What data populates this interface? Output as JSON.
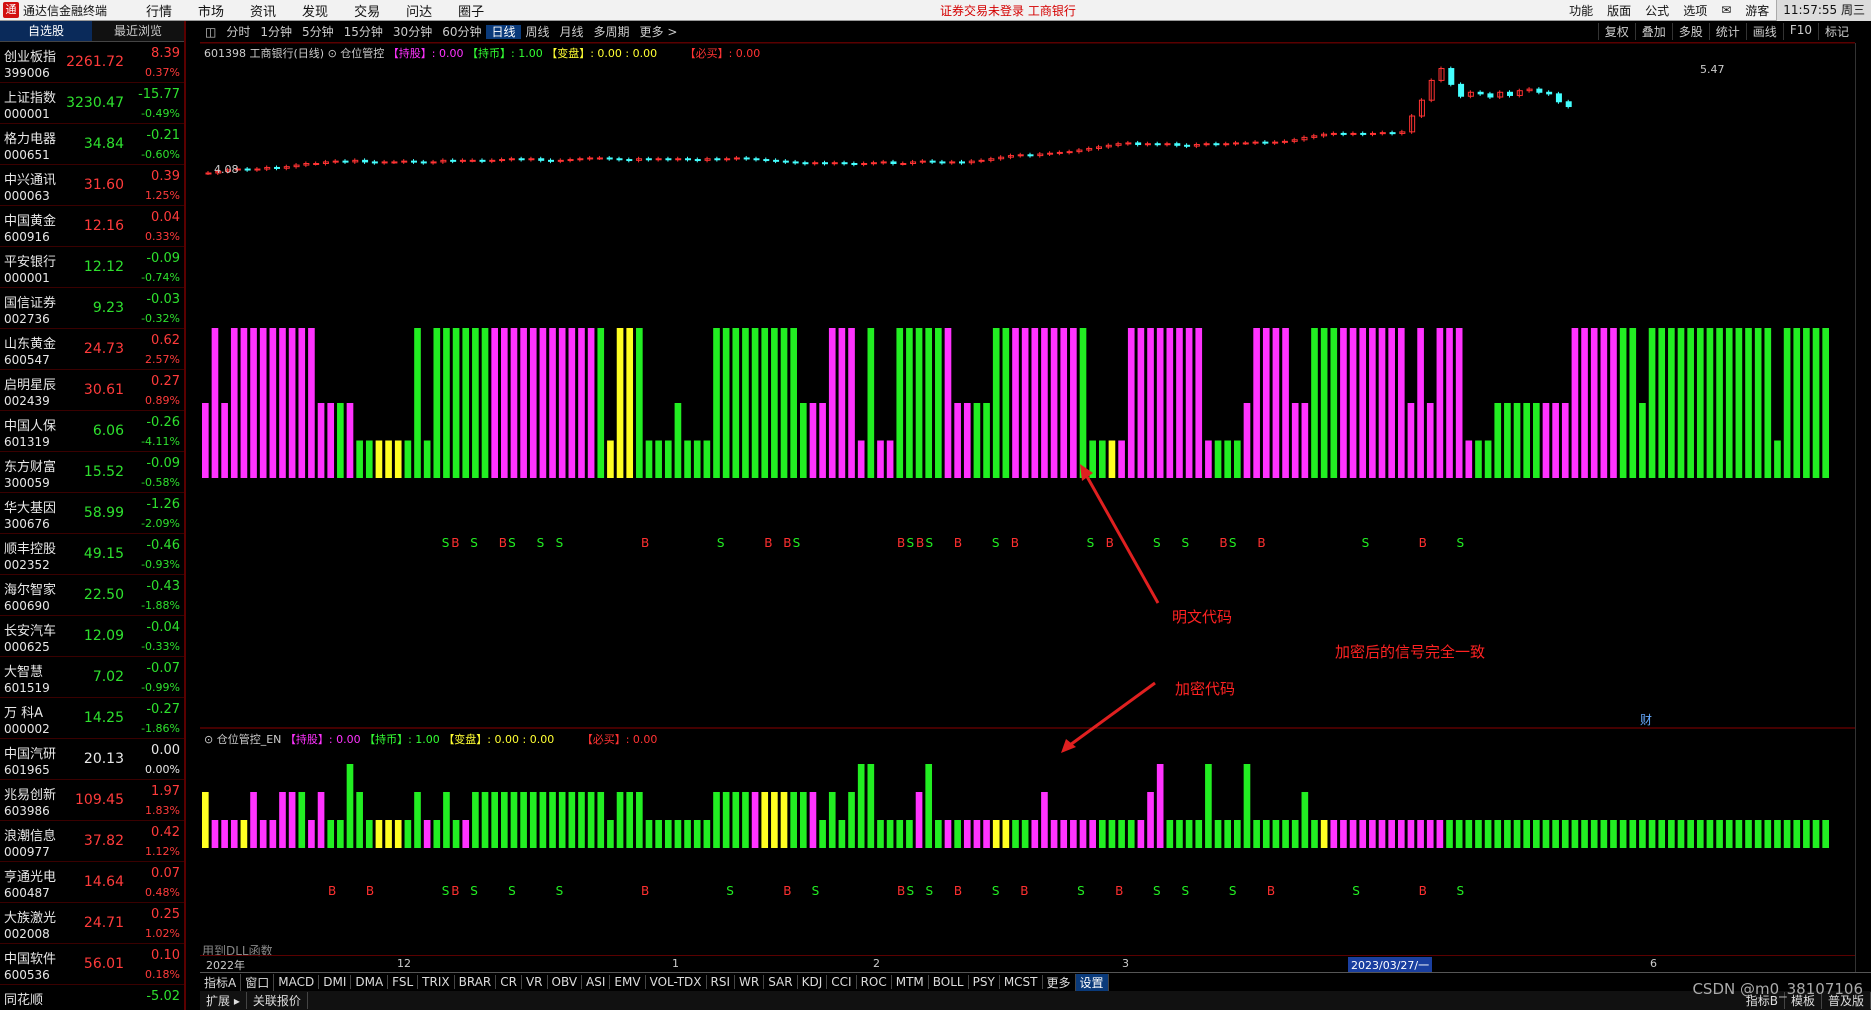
{
  "app": {
    "logo_glyph": "通",
    "title": "通达信金融终端",
    "menu": [
      "行情",
      "市场",
      "资讯",
      "发现",
      "交易",
      "问达",
      "圈子"
    ],
    "notice": "证券交易未登录   工商银行",
    "right_menu": [
      "功能",
      "版面",
      "公式",
      "选项",
      "✉",
      "游客"
    ],
    "time": "11:57:55 周三"
  },
  "watchlist": {
    "tabs": [
      "自选股",
      "最近浏览"
    ],
    "items": [
      {
        "name": "创业板指",
        "code": "399006",
        "price": "2261.72",
        "change": "8.39",
        "pct": "0.37%",
        "dir": "up"
      },
      {
        "name": "上证指数",
        "code": "000001",
        "price": "3230.47",
        "change": "-15.77",
        "pct": "-0.49%",
        "dir": "dn"
      },
      {
        "name": "格力电器",
        "code": "000651",
        "price": "34.84",
        "change": "-0.21",
        "pct": "-0.60%",
        "dir": "dn"
      },
      {
        "name": "中兴通讯",
        "code": "000063",
        "price": "31.60",
        "change": "0.39",
        "pct": "1.25%",
        "dir": "up"
      },
      {
        "name": "中国黄金",
        "code": "600916",
        "price": "12.16",
        "change": "0.04",
        "pct": "0.33%",
        "dir": "up"
      },
      {
        "name": "平安银行",
        "code": "000001",
        "price": "12.12",
        "change": "-0.09",
        "pct": "-0.74%",
        "dir": "dn"
      },
      {
        "name": "国信证券",
        "code": "002736",
        "price": "9.23",
        "change": "-0.03",
        "pct": "-0.32%",
        "dir": "dn"
      },
      {
        "name": "山东黄金",
        "code": "600547",
        "price": "24.73",
        "change": "0.62",
        "pct": "2.57%",
        "dir": "up"
      },
      {
        "name": "启明星辰",
        "code": "002439",
        "price": "30.61",
        "change": "0.27",
        "pct": "0.89%",
        "dir": "up"
      },
      {
        "name": "中国人保",
        "code": "601319",
        "price": "6.06",
        "change": "-0.26",
        "pct": "-4.11%",
        "dir": "dn"
      },
      {
        "name": "东方财富",
        "code": "300059",
        "price": "15.52",
        "change": "-0.09",
        "pct": "-0.58%",
        "dir": "dn"
      },
      {
        "name": "华大基因",
        "code": "300676",
        "price": "58.99",
        "change": "-1.26",
        "pct": "-2.09%",
        "dir": "dn"
      },
      {
        "name": "顺丰控股",
        "code": "002352",
        "price": "49.15",
        "change": "-0.46",
        "pct": "-0.93%",
        "dir": "dn"
      },
      {
        "name": "海尔智家",
        "code": "600690",
        "price": "22.50",
        "change": "-0.43",
        "pct": "-1.88%",
        "dir": "dn"
      },
      {
        "name": "长安汽车",
        "code": "000625",
        "price": "12.09",
        "change": "-0.04",
        "pct": "-0.33%",
        "dir": "dn"
      },
      {
        "name": "大智慧",
        "code": "601519",
        "price": "7.02",
        "change": "-0.07",
        "pct": "-0.99%",
        "dir": "dn"
      },
      {
        "name": "万 科A",
        "code": "000002",
        "price": "14.25",
        "change": "-0.27",
        "pct": "-1.86%",
        "dir": "dn"
      },
      {
        "name": "中国汽研",
        "code": "601965",
        "price": "20.13",
        "change": "0.00",
        "pct": "0.00%",
        "dir": "flat"
      },
      {
        "name": "兆易创新",
        "code": "603986",
        "price": "109.45",
        "change": "1.97",
        "pct": "1.83%",
        "dir": "up"
      },
      {
        "name": "浪潮信息",
        "code": "000977",
        "price": "37.82",
        "change": "0.42",
        "pct": "1.12%",
        "dir": "up"
      },
      {
        "name": "亨通光电",
        "code": "600487",
        "price": "14.64",
        "change": "0.07",
        "pct": "0.48%",
        "dir": "up"
      },
      {
        "name": "大族激光",
        "code": "002008",
        "price": "24.71",
        "change": "0.25",
        "pct": "1.02%",
        "dir": "up"
      },
      {
        "name": "中国软件",
        "code": "600536",
        "price": "56.01",
        "change": "0.10",
        "pct": "0.18%",
        "dir": "up"
      },
      {
        "name": "同花顺",
        "code": "",
        "price": "",
        "change": "-5.02",
        "pct": "",
        "dir": "dn"
      }
    ]
  },
  "toolbar": {
    "periods": [
      "分时",
      "1分钟",
      "5分钟",
      "15分钟",
      "30分钟",
      "60分钟",
      "日线",
      "周线",
      "月线",
      "多周期",
      "更多 >"
    ],
    "active_period": "日线",
    "tools": [
      "复权",
      "叠加",
      "多股",
      "统计",
      "画线",
      "F10",
      "标记"
    ]
  },
  "main_chart": {
    "stock_title": "601398 工商银行(日线)",
    "indicator": "仓位管控",
    "legend": {
      "hold": "【持股】: 0.00",
      "coin": "【持币】: 1.00",
      "change": "【变盘】: 0.00 : 0.00",
      "buy": "【必买】: 0.00"
    },
    "high_label": "5.47",
    "low_label": "4.08"
  },
  "lower_panel": {
    "indicator": "仓位管控_EN",
    "legend": {
      "hold": "【持股】: 0.00",
      "coin": "【持币】: 1.00",
      "change": "【变盘】: 0.00 : 0.00",
      "buy": "【必买】: 0.00"
    },
    "fin_mark": "财",
    "hint": "用到DLL函数"
  },
  "annotations": {
    "plain_code": "明文代码",
    "same_signal": "加密后的信号完全一致",
    "encrypted_code": "加密代码"
  },
  "date_axis": {
    "labels": [
      "2022年",
      "12",
      "1",
      "2",
      "3",
      "6"
    ],
    "cursor_date": "2023/03/27/一"
  },
  "indicator_tabs": [
    "指标A",
    "窗口",
    "MACD",
    "DMI",
    "DMA",
    "FSL",
    "TRIX",
    "BRAR",
    "CR",
    "VR",
    "OBV",
    "ASI",
    "EMV",
    "VOL-TDX",
    "RSI",
    "WR",
    "SAR",
    "KDJ",
    "CCI",
    "ROC",
    "MTM",
    "BOLL",
    "PSY",
    "MCST",
    "更多",
    "设置"
  ],
  "active_indicator_tab": "设置",
  "status_bar": [
    "扩展 ▸",
    "关联报价"
  ],
  "right_tabs": [
    "指标B",
    "模板",
    "普及版"
  ],
  "watermark": "CSDN @m0_38107106",
  "chart_data": [
    {
      "type": "bar",
      "name": "仓位管控",
      "colors": {
        "hold": "#ff33ff",
        "coin": "#22ee22",
        "change": "#ffff22"
      },
      "levels": [
        2,
        4,
        2,
        4,
        4,
        4,
        4,
        4,
        4,
        4,
        4,
        4,
        2,
        2,
        2,
        2,
        1,
        1,
        1,
        1,
        1,
        1,
        4,
        1,
        4,
        4,
        4,
        4,
        4,
        4,
        4,
        4,
        4,
        4,
        4,
        4,
        4,
        4,
        4,
        4,
        4,
        4,
        1,
        4,
        4,
        4,
        1,
        1,
        1,
        2,
        1,
        1,
        1,
        4,
        4,
        4,
        4,
        4,
        4,
        4,
        4,
        4,
        2,
        2,
        2,
        4,
        4,
        4,
        1,
        4,
        1,
        1,
        4,
        4,
        4,
        4,
        4,
        4,
        2,
        2,
        2,
        2,
        4,
        4,
        4,
        4,
        4,
        4,
        4,
        4,
        4,
        4,
        1,
        1,
        1,
        1,
        4,
        4,
        4,
        4,
        4,
        4,
        4,
        4,
        1,
        1,
        1,
        1,
        2,
        4,
        4,
        4,
        4,
        2,
        2,
        4,
        4,
        4,
        4,
        4,
        4,
        4,
        4,
        4,
        4,
        2,
        4,
        2,
        4,
        4,
        4,
        1,
        1,
        1,
        2,
        2,
        2,
        2,
        2,
        2,
        2,
        2,
        4,
        4,
        4,
        4,
        4,
        4,
        4,
        2,
        4,
        4,
        4,
        4,
        4,
        4,
        4,
        4,
        4,
        4,
        4,
        4,
        4,
        1,
        4,
        4,
        4,
        4,
        4
      ],
      "kinds": [
        "h",
        "h",
        "h",
        "h",
        "h",
        "h",
        "h",
        "h",
        "h",
        "h",
        "h",
        "h",
        "h",
        "h",
        "c",
        "h",
        "g",
        "c",
        "y",
        "y",
        "y",
        "c",
        "c",
        "g",
        "c",
        "c",
        "c",
        "c",
        "c",
        "c",
        "h",
        "h",
        "h",
        "h",
        "h",
        "h",
        "h",
        "h",
        "h",
        "h",
        "h",
        "c",
        "y",
        "y",
        "y",
        "c",
        "c",
        "c",
        "c",
        "c",
        "c",
        "c",
        "c",
        "c",
        "c",
        "c",
        "c",
        "c",
        "c",
        "c",
        "c",
        "c",
        "c",
        "h",
        "h",
        "h",
        "h",
        "h",
        "h",
        "c",
        "h",
        "h",
        "c",
        "c",
        "c",
        "c",
        "c",
        "h",
        "h",
        "h",
        "c",
        "c",
        "c",
        "c",
        "h",
        "h",
        "h",
        "h",
        "h",
        "h",
        "h",
        "c",
        "c",
        "c",
        "y",
        "h",
        "h",
        "h",
        "h",
        "h",
        "h",
        "h",
        "h",
        "h",
        "h",
        "c",
        "c",
        "c",
        "h",
        "h",
        "h",
        "h",
        "h",
        "h",
        "h",
        "c",
        "c",
        "c",
        "h",
        "h",
        "h",
        "h",
        "h",
        "h",
        "h",
        "h",
        "h",
        "h",
        "h",
        "h",
        "h",
        "h",
        "c",
        "c",
        "c",
        "c",
        "c",
        "c",
        "c",
        "h",
        "h",
        "h",
        "h",
        "h",
        "h",
        "h",
        "h",
        "c",
        "c",
        "c",
        "c",
        "c",
        "c",
        "c",
        "c",
        "c",
        "c",
        "c",
        "c",
        "c",
        "c",
        "c",
        "c",
        "c",
        "c",
        "c",
        "c",
        "c"
      ],
      "signals": [
        {
          "i": 12,
          "t": "S"
        },
        {
          "i": 13,
          "t": "B"
        },
        {
          "i": 15,
          "t": "S"
        },
        {
          "i": 18,
          "t": "B"
        },
        {
          "i": 19,
          "t": "S"
        },
        {
          "i": 22,
          "t": "S"
        },
        {
          "i": 24,
          "t": "S"
        },
        {
          "i": 33,
          "t": "B"
        },
        {
          "i": 41,
          "t": "S"
        },
        {
          "i": 46,
          "t": "B"
        },
        {
          "i": 48,
          "t": "B"
        },
        {
          "i": 49,
          "t": "S"
        },
        {
          "i": 60,
          "t": "B"
        },
        {
          "i": 61,
          "t": "S"
        },
        {
          "i": 62,
          "t": "B"
        },
        {
          "i": 63,
          "t": "S"
        },
        {
          "i": 66,
          "t": "B"
        },
        {
          "i": 70,
          "t": "S"
        },
        {
          "i": 72,
          "t": "B"
        },
        {
          "i": 80,
          "t": "S"
        },
        {
          "i": 82,
          "t": "B"
        },
        {
          "i": 87,
          "t": "S"
        },
        {
          "i": 90,
          "t": "S"
        },
        {
          "i": 94,
          "t": "B"
        },
        {
          "i": 95,
          "t": "S"
        },
        {
          "i": 98,
          "t": "B"
        },
        {
          "i": 109,
          "t": "S"
        },
        {
          "i": 115,
          "t": "B"
        },
        {
          "i": 119,
          "t": "S"
        }
      ]
    },
    {
      "type": "bar",
      "name": "仓位管控_EN",
      "levels": [
        2,
        1,
        1,
        1,
        1,
        2,
        1,
        1,
        2,
        2,
        2,
        1,
        2,
        1,
        1,
        3,
        2,
        1,
        1,
        1,
        1,
        1,
        2,
        1,
        1,
        2,
        1,
        1,
        2,
        2,
        2,
        2,
        2,
        2,
        2,
        2,
        2,
        2,
        2,
        2,
        2,
        2,
        1,
        2,
        2,
        2,
        1,
        1,
        1,
        1,
        1,
        1,
        1,
        2,
        2,
        2,
        2,
        2,
        2,
        2,
        2,
        2,
        2,
        2,
        1,
        2,
        1,
        2,
        3,
        3,
        1,
        1,
        1,
        1,
        2,
        3,
        1,
        1,
        1,
        1,
        1,
        1,
        1,
        1,
        1,
        1,
        1,
        2,
        1,
        1,
        1,
        1,
        1,
        1,
        1,
        1,
        1,
        1,
        2,
        3,
        1,
        1,
        1,
        1,
        3,
        1,
        1,
        1,
        3,
        1,
        1,
        1,
        1,
        1,
        2,
        1,
        1,
        1,
        1,
        1,
        1,
        1,
        1,
        1,
        1,
        1,
        1,
        1,
        1,
        1,
        1,
        1,
        1,
        1,
        1,
        1,
        1,
        1,
        1,
        1,
        1,
        1,
        1,
        1,
        1,
        1,
        1,
        1,
        1,
        1,
        1,
        1,
        1,
        1,
        1,
        1,
        1,
        1,
        1,
        1,
        1,
        1,
        1,
        1,
        1,
        1,
        1,
        1,
        1
      ],
      "kinds": [
        "y",
        "h",
        "h",
        "h",
        "y",
        "h",
        "h",
        "h",
        "h",
        "h",
        "g",
        "h",
        "h",
        "g",
        "g",
        "g",
        "g",
        "c",
        "y",
        "y",
        "y",
        "c",
        "c",
        "h",
        "c",
        "c",
        "c",
        "h",
        "c",
        "c",
        "c",
        "c",
        "c",
        "c",
        "c",
        "c",
        "c",
        "c",
        "c",
        "c",
        "c",
        "c",
        "c",
        "c",
        "c",
        "c",
        "c",
        "c",
        "c",
        "c",
        "c",
        "c",
        "c",
        "c",
        "c",
        "c",
        "c",
        "h",
        "y",
        "y",
        "y",
        "c",
        "c",
        "h",
        "c",
        "c",
        "c",
        "c",
        "c",
        "c",
        "c",
        "c",
        "c",
        "c",
        "h",
        "c",
        "c",
        "h",
        "c",
        "h",
        "h",
        "h",
        "y",
        "y",
        "c",
        "c",
        "h",
        "h",
        "h",
        "h",
        "h",
        "h",
        "h",
        "c",
        "c",
        "c",
        "c",
        "h",
        "h",
        "h",
        "c",
        "c",
        "c",
        "c",
        "c",
        "c",
        "c",
        "c",
        "c",
        "c",
        "c",
        "c",
        "c",
        "c",
        "c",
        "c",
        "y",
        "h",
        "h",
        "h",
        "h",
        "h",
        "h",
        "h",
        "h",
        "h",
        "h",
        "h",
        "h",
        "c",
        "c",
        "c",
        "c",
        "c",
        "c",
        "c",
        "c",
        "c",
        "c",
        "c",
        "c",
        "c",
        "c",
        "c",
        "c",
        "c",
        "c",
        "c",
        "c",
        "c",
        "c",
        "c",
        "c",
        "c",
        "c",
        "c",
        "c",
        "c",
        "c",
        "c",
        "c",
        "c",
        "c",
        "c",
        "c",
        "c",
        "c",
        "c",
        "c",
        "c",
        "c",
        "c",
        "c",
        "c"
      ],
      "signals": [
        {
          "i": 0,
          "t": "B"
        },
        {
          "i": 4,
          "t": "B"
        },
        {
          "i": 12,
          "t": "S"
        },
        {
          "i": 13,
          "t": "B"
        },
        {
          "i": 15,
          "t": "S"
        },
        {
          "i": 19,
          "t": "S"
        },
        {
          "i": 24,
          "t": "S"
        },
        {
          "i": 33,
          "t": "B"
        },
        {
          "i": 42,
          "t": "S"
        },
        {
          "i": 48,
          "t": "B"
        },
        {
          "i": 51,
          "t": "S"
        },
        {
          "i": 60,
          "t": "B"
        },
        {
          "i": 61,
          "t": "S"
        },
        {
          "i": 63,
          "t": "S"
        },
        {
          "i": 66,
          "t": "B"
        },
        {
          "i": 70,
          "t": "S"
        },
        {
          "i": 73,
          "t": "B"
        },
        {
          "i": 79,
          "t": "S"
        },
        {
          "i": 83,
          "t": "B"
        },
        {
          "i": 87,
          "t": "S"
        },
        {
          "i": 90,
          "t": "S"
        },
        {
          "i": 95,
          "t": "S"
        },
        {
          "i": 99,
          "t": "B"
        },
        {
          "i": 108,
          "t": "S"
        },
        {
          "i": 115,
          "t": "B"
        },
        {
          "i": 119,
          "t": "S"
        }
      ]
    },
    {
      "type": "candlestick",
      "name": "601398 工商银行(日线)",
      "close": [
        4.08,
        4.1,
        4.12,
        4.13,
        4.12,
        4.13,
        4.15,
        4.14,
        4.16,
        4.18,
        4.2,
        4.2,
        4.22,
        4.23,
        4.22,
        4.24,
        4.22,
        4.21,
        4.22,
        4.22,
        4.23,
        4.22,
        4.21,
        4.22,
        4.24,
        4.23,
        4.24,
        4.24,
        4.23,
        4.24,
        4.25,
        4.26,
        4.25,
        4.26,
        4.24,
        4.23,
        4.24,
        4.25,
        4.26,
        4.27,
        4.27,
        4.26,
        4.25,
        4.24,
        4.26,
        4.25,
        4.26,
        4.25,
        4.26,
        4.25,
        4.24,
        4.26,
        4.25,
        4.26,
        4.27,
        4.26,
        4.25,
        4.24,
        4.23,
        4.22,
        4.21,
        4.2,
        4.21,
        4.2,
        4.21,
        4.2,
        4.19,
        4.2,
        4.21,
        4.22,
        4.2,
        4.2,
        4.22,
        4.23,
        4.22,
        4.21,
        4.22,
        4.21,
        4.23,
        4.24,
        4.26,
        4.28,
        4.3,
        4.31,
        4.3,
        4.32,
        4.33,
        4.34,
        4.35,
        4.37,
        4.39,
        4.41,
        4.43,
        4.45,
        4.46,
        4.44,
        4.45,
        4.44,
        4.45,
        4.43,
        4.42,
        4.44,
        4.45,
        4.44,
        4.45,
        4.46,
        4.46,
        4.47,
        4.46,
        4.47,
        4.48,
        4.5,
        4.53,
        4.55,
        4.57,
        4.58,
        4.57,
        4.58,
        4.57,
        4.58,
        4.59,
        4.58,
        4.6,
        4.8,
        5.0,
        5.25,
        5.4,
        5.2,
        5.05,
        5.1,
        5.08,
        5.04,
        5.1,
        5.06,
        5.12,
        5.14,
        5.1,
        5.08,
        4.98,
        4.92
      ],
      "high": 5.47,
      "low": 4.08
    }
  ]
}
